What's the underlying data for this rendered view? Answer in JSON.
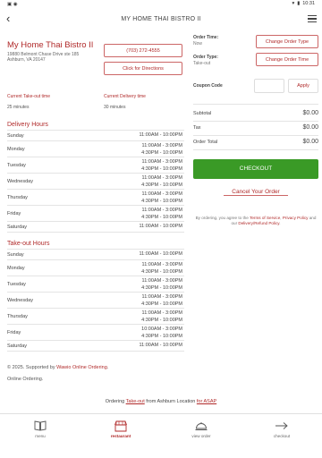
{
  "status_bar": {
    "time": "10:31"
  },
  "header": {
    "title": "MY HOME THAI BISTRO II"
  },
  "restaurant": {
    "name": "My Home Thai Bistro II",
    "address_line1": "19880 Belmont Chase Drive ste 185",
    "address_line2": "Ashburn, VA 20147",
    "phone": "(703) 272-4555",
    "directions_label": "Click for Directions"
  },
  "current_times": {
    "takeout_label": "Current Take-out time",
    "takeout_value": "25 minutes",
    "delivery_label": "Current Delivery time",
    "delivery_value": "30 minutes"
  },
  "delivery_hours": {
    "title": "Delivery Hours",
    "rows": [
      {
        "day": "Sunday",
        "times": "11:00AM - 10:00PM"
      },
      {
        "day": "Monday",
        "times": "11:00AM - 3:00PM\n4:30PM - 10:00PM"
      },
      {
        "day": "Tuesday",
        "times": "11:00AM - 3:00PM\n4:30PM - 10:00PM"
      },
      {
        "day": "Wednesday",
        "times": "11:00AM - 3:00PM\n4:30PM - 10:00PM"
      },
      {
        "day": "Thursday",
        "times": "11:00AM - 3:00PM\n4:30PM - 10:00PM"
      },
      {
        "day": "Friday",
        "times": "11:00AM - 3:00PM\n4:30PM - 10:00PM"
      },
      {
        "day": "Saturday",
        "times": "11:00AM - 10:00PM"
      }
    ]
  },
  "takeout_hours": {
    "title": "Take-out Hours",
    "rows": [
      {
        "day": "Sunday",
        "times": "11:00AM - 10:00PM"
      },
      {
        "day": "Monday",
        "times": "11:00AM - 3:00PM\n4:30PM - 10:00PM"
      },
      {
        "day": "Tuesday",
        "times": "11:00AM - 3:00PM\n4:30PM - 10:00PM"
      },
      {
        "day": "Wednesday",
        "times": "11:00AM - 3:00PM\n4:30PM - 10:00PM"
      },
      {
        "day": "Thursday",
        "times": "11:00AM - 3:00PM\n4:30PM - 10:00PM"
      },
      {
        "day": "Friday",
        "times": "10:00AM - 3:00PM\n4:30PM - 10:00PM"
      },
      {
        "day": "Saturday",
        "times": "11:00AM - 10:00PM"
      }
    ]
  },
  "footer_note": {
    "text_prefix": "© 2025. Supported by",
    "link": "Wawio Online Ordering",
    "text_suffix": ".",
    "line2": "Online Ordering."
  },
  "order": {
    "time_label": "Order Time:",
    "time_value": "Now",
    "change_time_label": "Change Order Time",
    "type_label": "Order Type:",
    "type_value": "Take-out",
    "change_type_label": "Change Order Type",
    "coupon_label": "Coupon Code",
    "coupon_value": "",
    "apply_label": "Apply"
  },
  "summary": {
    "subtotal_label": "Subtotal",
    "subtotal_value": "$0.00",
    "tax_label": "Tax",
    "tax_value": "$0.00",
    "total_label": "Order Total",
    "total_value": "$0.00"
  },
  "checkout_label": "CHECKOUT",
  "cancel_label": "Cancel Your Order",
  "terms": {
    "prefix": "By ordering, you agree to the",
    "terms_link": "Terms of Service",
    "comma": ",",
    "privacy_link": "Privacy Policy",
    "middle": "and our",
    "refund_link": "Delivery/Refund Policy",
    "suffix": "."
  },
  "ordering_line": {
    "prefix": "Ordering",
    "type_link": "Take-out",
    "middle": "from Ashburn Location",
    "time_link": "for ASAP"
  },
  "nav": [
    {
      "label": "menu",
      "icon": "menu-book-icon"
    },
    {
      "label": "restaurant",
      "icon": "restaurant-icon"
    },
    {
      "label": "view order",
      "icon": "cloche-icon"
    },
    {
      "label": "checkout",
      "icon": "arrow-right-icon"
    }
  ],
  "colors": {
    "accent": "#b02a2a",
    "checkout": "#3a9a26"
  }
}
